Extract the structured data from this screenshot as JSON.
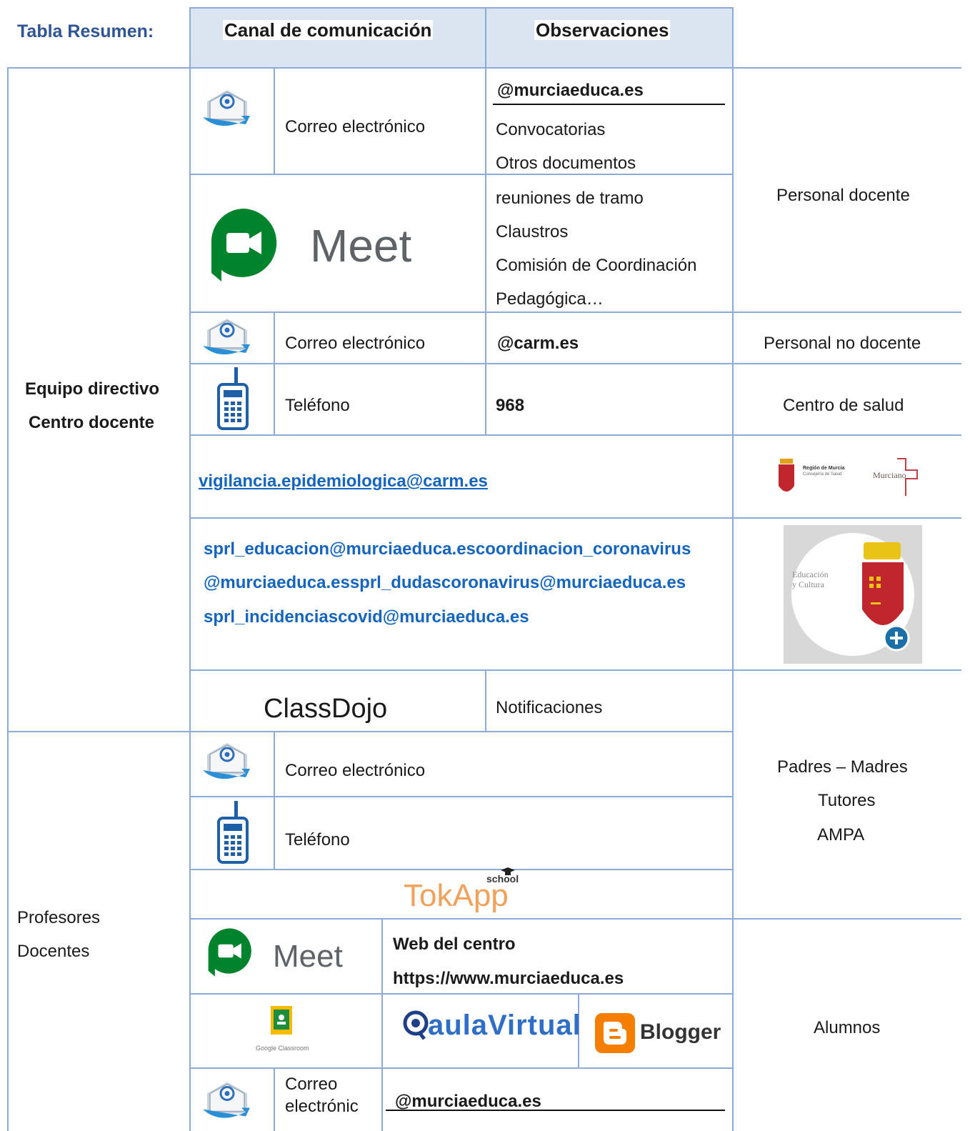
{
  "header": {
    "summary_title": "Tabla Resumen:",
    "col_channel": "Canal de comunicación",
    "col_observations": "Observaciones"
  },
  "rows": {
    "email_label": "Correo electrónico",
    "email_domain_edu": "@murciaeduca.es",
    "email_obs_1": "Convocatorias",
    "email_obs_2": "Otros documentos",
    "meet_label": "Meet",
    "meet_obs_1": "reuniones de tramo",
    "meet_obs_2": "Claustros",
    "meet_obs_3": "Comisión de Coordinación",
    "meet_obs_4": "Pedagógica…",
    "personal_docente": "Personal docente",
    "email_domain_carm": "@carm.es",
    "personal_no_docente": "Personal no docente",
    "phone_label": "Teléfono",
    "phone_prefix": "968",
    "centro_salud": "Centro de salud",
    "left_group_1_line1": "Equipo directivo",
    "left_group_1_line2": "Centro docente",
    "vigilancia_email": "vigilancia.epidemiologica@carm.es",
    "sprl_line1": "sprl_educacion@murciaeduca.escoordinacion_coronavirus",
    "sprl_line2": "@murciaeduca.essprl_dudascoronavirus@murciaeduca.es",
    "sprl_line3": "sprl_incidenciascovid@murciaeduca.es",
    "classdojo": "ClassDojo",
    "notificaciones": "Notificaciones",
    "padres_line1": "Padres – Madres",
    "padres_line2": "Tutores",
    "padres_line3": "AMPA",
    "tokapp_school": "school",
    "tokapp": "TokApp",
    "left_group_2_line1": "Profesores",
    "left_group_2_line2": "Docentes",
    "web_centro": "Web del centro",
    "web_url": "https://www.murciaeduca.es",
    "alumnos": "Alumnos",
    "aula_virtual": "aulaVirtual",
    "blogger": "Blogger",
    "classroom_caption": "Google Classroom",
    "email_short_line1": "Correo",
    "email_short_line2": "electrónic",
    "email_domain_edu_2": "@murciaeduca.es"
  },
  "logos": {
    "salud_region": "Región de Murcia",
    "salud_consejeria": "Consejería de Salud",
    "salud_servicio": "Murciano",
    "educacion_text_1": "Educación",
    "educacion_text_2": "y Cultura"
  },
  "colors": {
    "border": "#8eaadb",
    "header_bg": "#dbe5f1",
    "title_blue": "#2f5496",
    "link_blue": "#1565c0",
    "meet_green": "#00832d"
  }
}
